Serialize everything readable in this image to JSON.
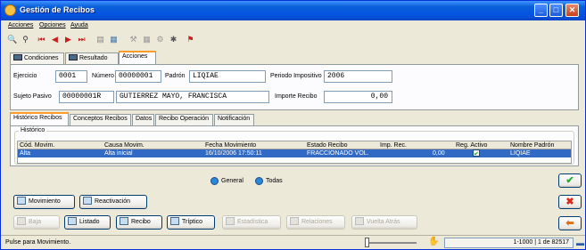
{
  "window": {
    "title": "Gestión de Recibos"
  },
  "menu": [
    "Acciones",
    "Opciones",
    "Ayuda"
  ],
  "toolbar_icons": [
    "search-icon",
    "binoculars-icon",
    "first-record-icon",
    "prev-record-icon",
    "next-record-icon",
    "last-record-icon",
    "print-icon",
    "export-icon",
    "tool-icon",
    "grid-icon",
    "gear-icon",
    "bug-icon",
    "flag-icon"
  ],
  "top_tabs": [
    "Condiciones",
    "Resultado",
    "Acciones"
  ],
  "form": {
    "ejercicio_label": "Ejercicio",
    "ejercicio": "0001",
    "numero_label": "Número",
    "numero": "00000001",
    "padron_label": "Padrón",
    "padron": "LIQIAE",
    "periodo_label": "Periodo Impositivo",
    "periodo": "2006",
    "sujeto_label": "Sujeto Pasivo",
    "sujeto_code": "00000001R",
    "sujeto_name": "GUTIERREZ MAYO, FRANCISCA",
    "importe_label": "Importe Recibo",
    "importe": "0,00"
  },
  "bottom_tabs": [
    "Histórico Recibos",
    "Conceptos Recibos",
    "Datos",
    "Recibo Operación",
    "Notificación"
  ],
  "history": {
    "group_label": "Histórico",
    "columns": [
      "Cód. Movim.",
      "Causa Movim.",
      "Fecha Movimiento",
      "Estado Recibo",
      "Imp. Rec.",
      "Reg. Activo",
      "Nombre Padrón"
    ],
    "rows": [
      [
        "Alta",
        "Alta inicial",
        "16/10/2006 17:50:11",
        "FRACCIONADO VOL.",
        "0,00",
        "✔",
        "LIQIAE"
      ]
    ]
  },
  "filters": {
    "general": "General",
    "todas": "Todas"
  },
  "buttons": {
    "movimiento": "Movimiento",
    "reactivacion": "Reactivación",
    "baja": "Baja",
    "listado": "Listado",
    "recibo": "Recibo",
    "triptico": "Tríptico",
    "estadistica": "Estadística",
    "relaciones": "Relaciones",
    "vuelta": "Vuelta Atrás"
  },
  "status": {
    "message": "Pulse para Movimiento.",
    "record": "1-1000 | 1 de 82517"
  },
  "colors": {
    "titlebar": "#0554e3",
    "selection": "#316ac5",
    "accept": "#2fa82f",
    "cancel": "#d92b1c"
  }
}
